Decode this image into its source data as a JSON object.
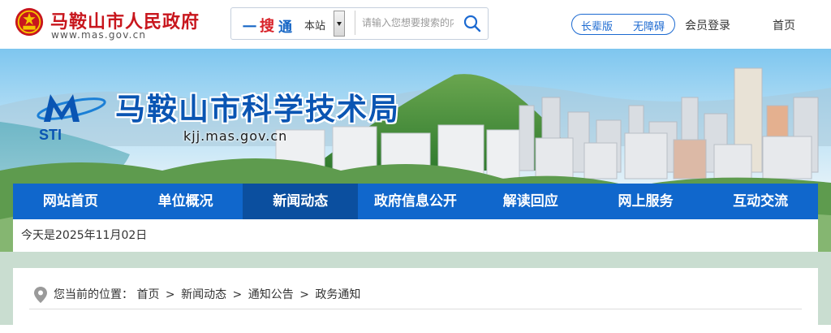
{
  "header": {
    "gov_title": "马鞍山市人民政府",
    "gov_url": "www.mas.gov.cn",
    "search": {
      "brand_yi": "一",
      "brand_sou": "搜",
      "brand_tong": "通",
      "scope_selected": "本站",
      "placeholder": "请输入您想要搜索的内容"
    },
    "elder_mode_label": "长辈版",
    "accessibility_label": "无障碍",
    "member_login": "会员登录",
    "home": "首页"
  },
  "banner": {
    "logo_text": "STI",
    "site_title": "马鞍山市科学技术局",
    "site_url": "kjj.mas.gov.cn"
  },
  "nav": {
    "items": [
      {
        "label": "网站首页"
      },
      {
        "label": "单位概况"
      },
      {
        "label": "新闻动态"
      },
      {
        "label": "政府信息公开"
      },
      {
        "label": "解读回应"
      },
      {
        "label": "网上服务"
      },
      {
        "label": "互动交流"
      }
    ],
    "active_index": 2
  },
  "date_text": "今天是2025年11月02日",
  "breadcrumb": {
    "prefix": "您当前的位置：",
    "items": [
      "首页",
      "新闻动态",
      "通知公告",
      "政务通知"
    ],
    "separator": ">"
  },
  "colors": {
    "gov_red": "#c8161d",
    "nav_blue": "#1067cc",
    "nav_active": "#0b4f9f",
    "title_blue": "#0a55b3"
  }
}
